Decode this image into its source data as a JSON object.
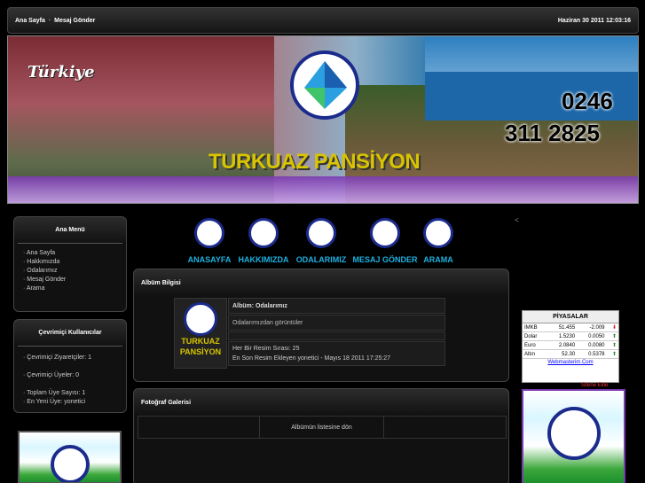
{
  "topbar": {
    "home_label": "Ana Sayfa",
    "separator": "·",
    "message_label": "Mesaj Gönder",
    "datetime": "Haziran 30 2011 12:03:16"
  },
  "banner": {
    "turkiye_text": "Türkiye",
    "phone_line1": "0246",
    "phone_line2": "311 2825",
    "title": "TURKUAZ PANSİYON"
  },
  "main_menu": {
    "title": "Ana Menü",
    "items": [
      "· Ana Sayfa",
      "· Hakkımızda",
      "· Odalarımız",
      "· Mesaj Gönder",
      "· Arama"
    ]
  },
  "online_users": {
    "title": "Çevrimiçi Kullanıcılar",
    "visitors": "· Çevrimiçi Ziyaretçiler: 1",
    "members": "· Çevrimiçi Üyeler: 0",
    "total_members": "· Toplam Üye Sayısı: 1",
    "newest_member": "· En Yeni Üye: yonetici"
  },
  "nav": {
    "items": [
      "ANASAYFA",
      "HAKKIMIZDA",
      "ODALARIMIZ",
      "MESAJ GÖNDER",
      "ARAMA"
    ]
  },
  "album": {
    "section_title": "Albüm Bilgisi",
    "thumb_title_line1": "TURKUAZ",
    "thumb_title_line2": "PANSİYON",
    "name": "Albüm: Odalarımız",
    "description": "Odalarımızdan görüntüler",
    "order": "Her Bir Resim Sırası: 25",
    "last_added": "En Son Resim Ekleyen yonetici - Mayıs 18 2011 17:25:27"
  },
  "gallery": {
    "section_title": "Fotoğraf Galerisi",
    "back_link": "Albümün listesine dön"
  },
  "right_side": {
    "stray_char": "<",
    "market_title": "PİYASALAR",
    "market_rows": [
      {
        "name": "IMKB",
        "value": "51.455",
        "change": "-2.009",
        "dir": "down"
      },
      {
        "name": "Dolar",
        "value": "1.5230",
        "change": "0.0050",
        "dir": "up"
      },
      {
        "name": "Euro",
        "value": "2.0840",
        "change": "0.0080",
        "dir": "up"
      },
      {
        "name": "Altın",
        "value": "52.30",
        "change": "0.5378",
        "dir": "up"
      }
    ],
    "market_footer": "Webmasterim.Com",
    "site_add": "Sitene Ekle"
  },
  "colors": {
    "nav_text": "#1eb0e0",
    "title_yellow": "#d8c400",
    "logo_ring": "#1b2b8c"
  }
}
